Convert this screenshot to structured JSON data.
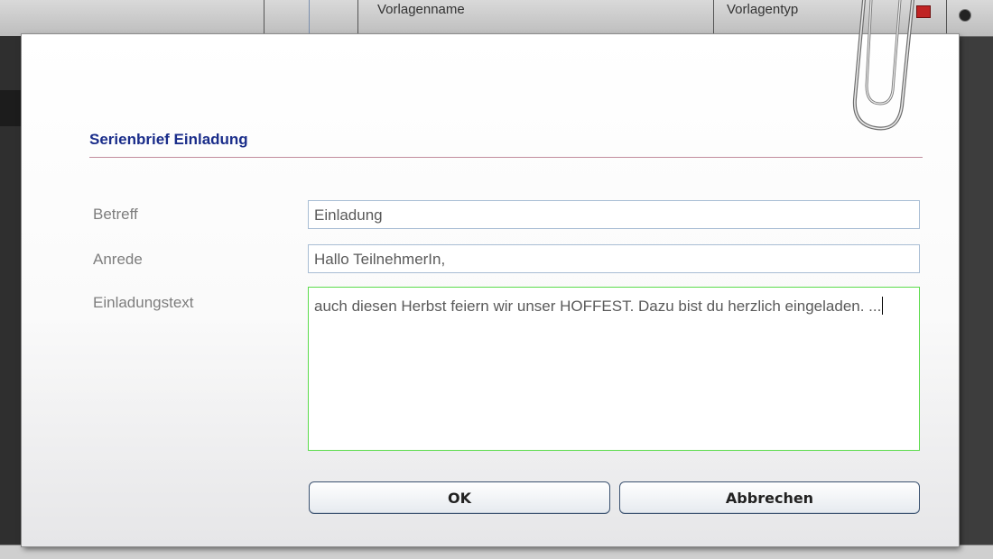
{
  "background": {
    "header_columns": [
      "Vorlagenname",
      "Vorlagentyp"
    ]
  },
  "dialog": {
    "title": "Serienbrief Einladung",
    "fields": {
      "betreff": {
        "label": "Betreff",
        "value": "Einladung"
      },
      "anrede": {
        "label": "Anrede",
        "value": "Hallo TeilnehmerIn,"
      },
      "einladungstext": {
        "label": "Einladungstext",
        "value": "auch diesen Herbst feiern wir unser HOFFEST. Dazu bist du herzlich eingeladen. ..."
      }
    },
    "buttons": {
      "ok": "OK",
      "cancel": "Abbrechen"
    },
    "accent_colors": {
      "title": "#1a2d8a",
      "title_rule": "#c28d9d",
      "field_border": "#a8bdd4",
      "focused_border": "#5cdc4c"
    }
  }
}
